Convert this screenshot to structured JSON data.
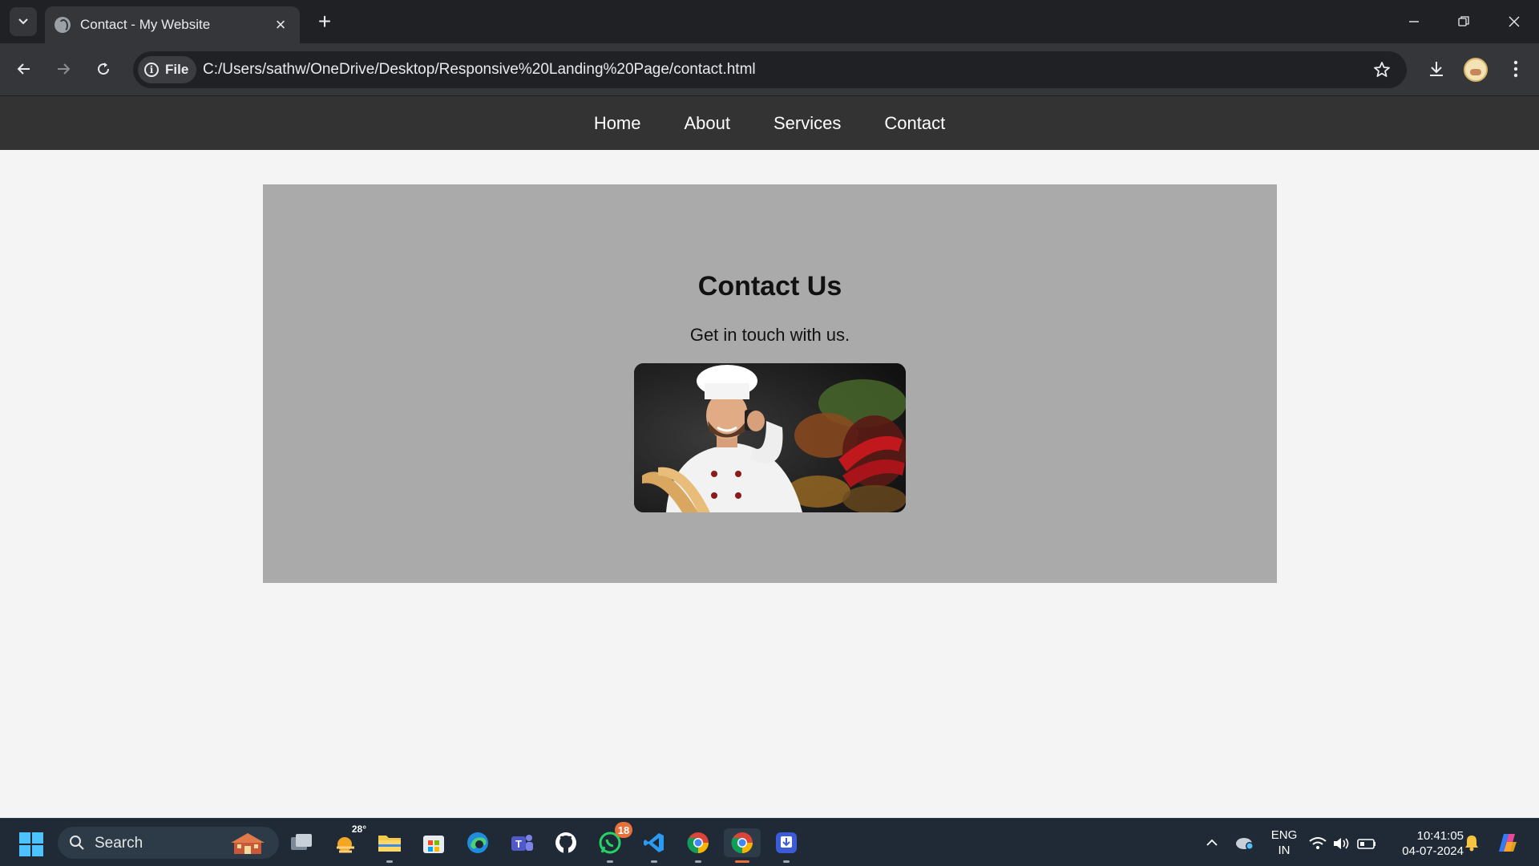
{
  "browser": {
    "tab_title": "Contact - My Website",
    "site_chip": "File",
    "url": "C:/Users/sathw/OneDrive/Desktop/Responsive%20Landing%20Page/contact.html"
  },
  "site": {
    "nav": [
      "Home",
      "About",
      "Services",
      "Contact"
    ],
    "heading": "Contact Us",
    "subheading": "Get in touch with us."
  },
  "taskbar": {
    "search_label": "Search",
    "weather_temp": "28°",
    "whatsapp_badge": "18",
    "lang_line1": "ENG",
    "lang_line2": "IN",
    "time": "10:41:05",
    "date": "04-07-2024"
  }
}
